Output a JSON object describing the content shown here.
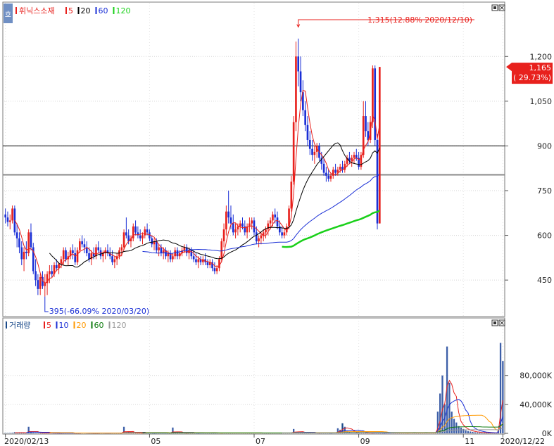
{
  "chart_data": [
    {
      "type": "candlestick",
      "legend": {
        "badge": "호",
        "title": "휘닉스소재",
        "items": [
          {
            "label": "5",
            "color": "#e8211d"
          },
          {
            "label": "20",
            "color": "#000000"
          },
          {
            "label": "60",
            "color": "#1a2fd6"
          },
          {
            "label": "120",
            "color": "#19d019"
          }
        ]
      },
      "ylim": [
        330,
        1380
      ],
      "y_ticks": [
        "1,200",
        "1,050",
        "900",
        "750",
        "600",
        "450"
      ],
      "y_tick_values": [
        1200,
        1050,
        900,
        750,
        600,
        450
      ],
      "hlines": [
        {
          "value": 900,
          "color": "#000000"
        },
        {
          "value": 803,
          "color": "#8a8a8a"
        }
      ],
      "annotations": {
        "high": {
          "text": "1,315(12.88% 2020/12/10)",
          "value": 1315,
          "color": "#e8211d"
        },
        "low": {
          "text": "395(-66.09% 2020/03/20)",
          "value": 395,
          "color": "#1a2fd6"
        }
      },
      "current": {
        "price": "1,165",
        "change": "( 29.73%)",
        "value": 1165
      },
      "bar_count": 215,
      "ohlc": [
        [
          670,
          690,
          640,
          660
        ],
        [
          660,
          680,
          630,
          645
        ],
        [
          645,
          670,
          620,
          650
        ],
        [
          650,
          700,
          640,
          690
        ],
        [
          690,
          700,
          600,
          610
        ],
        [
          610,
          640,
          560,
          590
        ],
        [
          590,
          610,
          540,
          560
        ],
        [
          560,
          580,
          500,
          520
        ],
        [
          520,
          560,
          480,
          545
        ],
        [
          545,
          580,
          520,
          540
        ],
        [
          540,
          620,
          530,
          610
        ],
        [
          610,
          640,
          550,
          560
        ],
        [
          560,
          575,
          470,
          480
        ],
        [
          480,
          520,
          430,
          450
        ],
        [
          450,
          470,
          400,
          420
        ],
        [
          420,
          470,
          400,
          460
        ],
        [
          460,
          480,
          420,
          430
        ],
        [
          430,
          470,
          395,
          440
        ],
        [
          440,
          480,
          400,
          470
        ],
        [
          470,
          500,
          440,
          480
        ],
        [
          480,
          500,
          460,
          470
        ],
        [
          470,
          510,
          460,
          500
        ],
        [
          500,
          520,
          480,
          490
        ],
        [
          490,
          510,
          470,
          505
        ],
        [
          505,
          530,
          490,
          520
        ],
        [
          520,
          560,
          500,
          550
        ],
        [
          550,
          560,
          510,
          520
        ],
        [
          520,
          545,
          500,
          530
        ],
        [
          530,
          560,
          520,
          550
        ],
        [
          550,
          570,
          520,
          540
        ],
        [
          540,
          560,
          500,
          510
        ],
        [
          510,
          560,
          500,
          550
        ],
        [
          550,
          590,
          540,
          580
        ],
        [
          580,
          600,
          560,
          570
        ],
        [
          570,
          590,
          540,
          560
        ],
        [
          560,
          580,
          530,
          540
        ],
        [
          540,
          560,
          510,
          520
        ],
        [
          520,
          550,
          500,
          540
        ],
        [
          540,
          560,
          520,
          530
        ],
        [
          530,
          570,
          520,
          560
        ],
        [
          560,
          580,
          540,
          550
        ],
        [
          550,
          560,
          520,
          530
        ],
        [
          530,
          550,
          510,
          540
        ],
        [
          540,
          560,
          520,
          550
        ],
        [
          550,
          570,
          530,
          540
        ],
        [
          540,
          560,
          520,
          530
        ],
        [
          530,
          550,
          500,
          510
        ],
        [
          510,
          530,
          490,
          520
        ],
        [
          520,
          540,
          500,
          530
        ],
        [
          530,
          560,
          520,
          550
        ],
        [
          550,
          570,
          530,
          560
        ],
        [
          560,
          620,
          550,
          610
        ],
        [
          610,
          660,
          590,
          600
        ],
        [
          600,
          620,
          570,
          580
        ],
        [
          580,
          600,
          560,
          590
        ],
        [
          590,
          640,
          580,
          630
        ],
        [
          630,
          650,
          600,
          610
        ],
        [
          610,
          630,
          590,
          600
        ],
        [
          600,
          620,
          580,
          590
        ],
        [
          590,
          610,
          570,
          600
        ],
        [
          600,
          630,
          590,
          620
        ],
        [
          620,
          640,
          600,
          610
        ],
        [
          610,
          620,
          580,
          590
        ],
        [
          590,
          600,
          560,
          570
        ],
        [
          570,
          590,
          550,
          580
        ],
        [
          580,
          590,
          540,
          550
        ],
        [
          550,
          570,
          530,
          560
        ],
        [
          560,
          570,
          530,
          540
        ],
        [
          540,
          560,
          520,
          550
        ],
        [
          550,
          560,
          520,
          530
        ],
        [
          530,
          550,
          510,
          540
        ],
        [
          540,
          550,
          510,
          520
        ],
        [
          520,
          540,
          510,
          530
        ],
        [
          530,
          560,
          520,
          550
        ],
        [
          550,
          560,
          520,
          530
        ],
        [
          530,
          550,
          520,
          540
        ],
        [
          540,
          560,
          530,
          550
        ],
        [
          550,
          570,
          540,
          560
        ],
        [
          560,
          570,
          530,
          540
        ],
        [
          540,
          560,
          520,
          550
        ],
        [
          550,
          560,
          520,
          530
        ],
        [
          530,
          550,
          510,
          520
        ],
        [
          520,
          540,
          500,
          510
        ],
        [
          510,
          530,
          490,
          520
        ],
        [
          520,
          530,
          500,
          510
        ],
        [
          510,
          530,
          500,
          520
        ],
        [
          520,
          540,
          500,
          510
        ],
        [
          510,
          520,
          490,
          500
        ],
        [
          500,
          520,
          490,
          510
        ],
        [
          510,
          520,
          480,
          490
        ],
        [
          490,
          510,
          470,
          480
        ],
        [
          480,
          500,
          470,
          490
        ],
        [
          490,
          530,
          480,
          520
        ],
        [
          520,
          590,
          510,
          580
        ],
        [
          580,
          640,
          560,
          620
        ],
        [
          620,
          700,
          600,
          680
        ],
        [
          680,
          750,
          640,
          660
        ],
        [
          660,
          700,
          620,
          640
        ],
        [
          640,
          670,
          600,
          610
        ],
        [
          610,
          640,
          590,
          620
        ],
        [
          620,
          640,
          600,
          630
        ],
        [
          630,
          650,
          610,
          640
        ],
        [
          640,
          660,
          620,
          630
        ],
        [
          630,
          650,
          600,
          610
        ],
        [
          610,
          640,
          590,
          630
        ],
        [
          630,
          660,
          610,
          640
        ],
        [
          640,
          660,
          620,
          650
        ],
        [
          650,
          660,
          600,
          610
        ],
        [
          610,
          630,
          570,
          580
        ],
        [
          580,
          600,
          560,
          590
        ],
        [
          590,
          610,
          570,
          600
        ],
        [
          600,
          620,
          580,
          610
        ],
        [
          610,
          630,
          590,
          620
        ],
        [
          620,
          650,
          600,
          640
        ],
        [
          640,
          660,
          620,
          650
        ],
        [
          650,
          680,
          630,
          670
        ],
        [
          670,
          690,
          640,
          660
        ],
        [
          660,
          680,
          620,
          630
        ],
        [
          630,
          650,
          600,
          610
        ],
        [
          610,
          630,
          590,
          600
        ],
        [
          600,
          620,
          590,
          610
        ],
        [
          610,
          640,
          600,
          630
        ],
        [
          630,
          700,
          620,
          690
        ],
        [
          690,
          800,
          680,
          780
        ],
        [
          780,
          1000,
          770,
          980
        ],
        [
          980,
          1250,
          950,
          1200
        ],
        [
          1200,
          1260,
          1100,
          1150
        ],
        [
          1150,
          1200,
          1050,
          1080
        ],
        [
          1080,
          1120,
          1000,
          1020
        ],
        [
          1020,
          1050,
          950,
          970
        ],
        [
          970,
          1000,
          900,
          920
        ],
        [
          920,
          950,
          870,
          890
        ],
        [
          890,
          920,
          850,
          870
        ],
        [
          870,
          900,
          840,
          880
        ],
        [
          880,
          910,
          860,
          900
        ],
        [
          900,
          910,
          850,
          860
        ],
        [
          860,
          880,
          820,
          840
        ],
        [
          840,
          860,
          800,
          810
        ],
        [
          810,
          830,
          780,
          800
        ],
        [
          800,
          820,
          780,
          790
        ],
        [
          790,
          810,
          780,
          800
        ],
        [
          800,
          830,
          790,
          820
        ],
        [
          820,
          840,
          800,
          810
        ],
        [
          810,
          830,
          800,
          820
        ],
        [
          820,
          840,
          810,
          830
        ],
        [
          830,
          850,
          810,
          820
        ],
        [
          820,
          850,
          810,
          840
        ],
        [
          840,
          870,
          830,
          860
        ],
        [
          860,
          880,
          840,
          850
        ],
        [
          850,
          870,
          830,
          860
        ],
        [
          860,
          880,
          840,
          870
        ],
        [
          870,
          890,
          850,
          860
        ],
        [
          860,
          880,
          820,
          830
        ],
        [
          830,
          880,
          820,
          870
        ],
        [
          870,
          1050,
          860,
          1000
        ],
        [
          1000,
          1050,
          930,
          950
        ],
        [
          950,
          980,
          900,
          920
        ],
        [
          920,
          1000,
          910,
          980
        ],
        [
          980,
          1170,
          960,
          1160
        ],
        [
          1160,
          1170,
          900,
          920
        ],
        [
          920,
          940,
          620,
          640
        ],
        [
          640,
          1165,
          640,
          1165
        ]
      ]
    },
    {
      "type": "bar",
      "legend": {
        "title": "거래량",
        "items": [
          {
            "label": "5",
            "color": "#e8211d"
          },
          {
            "label": "10",
            "color": "#1a2fd6"
          },
          {
            "label": "20",
            "color": "#ff9900"
          },
          {
            "label": "60",
            "color": "#0d7a0d"
          },
          {
            "label": "120",
            "color": "#9a9a9a"
          }
        ]
      },
      "ylim": [
        0,
        140000
      ],
      "y_ticks": [
        "80,000K",
        "40,000K",
        "0K"
      ],
      "y_tick_values": [
        80000,
        40000,
        0
      ],
      "volume": [
        500,
        400,
        600,
        800,
        1500,
        1200,
        900,
        700,
        600,
        500,
        9000,
        1200,
        800,
        600,
        500,
        400,
        600,
        500,
        400,
        300,
        400,
        500,
        300,
        400,
        500,
        600,
        400,
        300,
        400,
        500,
        300,
        400,
        500,
        600,
        500,
        400,
        300,
        400,
        300,
        400,
        500,
        600,
        400,
        300,
        400,
        500,
        600,
        400,
        300,
        400,
        400,
        9000,
        1500,
        800,
        600,
        500,
        400,
        300,
        400,
        500,
        600,
        400,
        300,
        400,
        500,
        600,
        700,
        500,
        400,
        300,
        400,
        500,
        8000,
        600,
        500,
        400,
        300,
        400,
        500,
        600,
        400,
        300,
        400,
        500,
        600,
        400,
        300,
        400,
        500,
        600,
        400,
        300,
        400,
        500,
        600,
        400,
        300,
        400,
        500,
        600,
        400,
        300,
        400,
        500,
        600,
        400,
        300,
        400,
        500,
        600,
        400,
        300,
        400,
        500,
        600,
        400,
        300,
        400,
        500,
        600,
        400,
        300,
        400,
        500,
        6000,
        2000,
        1500,
        1200,
        1000,
        800,
        600,
        500,
        400,
        300,
        400,
        500,
        600,
        400,
        300,
        400,
        500,
        600,
        400,
        7000,
        5000,
        14000,
        9000,
        3000,
        2000,
        1500,
        1200,
        1000,
        800,
        600,
        500,
        400,
        300,
        400,
        500,
        600,
        400,
        300,
        400,
        500,
        600,
        400,
        300,
        400,
        500,
        600,
        400,
        300,
        400,
        500,
        600,
        400,
        300,
        400,
        500,
        600,
        400,
        300,
        400,
        500,
        600,
        400,
        30000,
        55000,
        80000,
        40000,
        120000,
        70000,
        30000,
        20000,
        15000,
        10000,
        8000,
        6000,
        4000,
        3000,
        2500,
        2000,
        1500,
        1200,
        1000,
        800,
        900,
        700,
        600,
        500,
        400,
        300,
        3000,
        125000,
        100000
      ]
    }
  ],
  "x_axis": {
    "labels": [
      "2020/02/13",
      "05",
      "07",
      "09",
      "11",
      "2020/12/22"
    ],
    "label_bars": [
      0,
      62,
      107,
      152,
      197,
      214
    ]
  }
}
